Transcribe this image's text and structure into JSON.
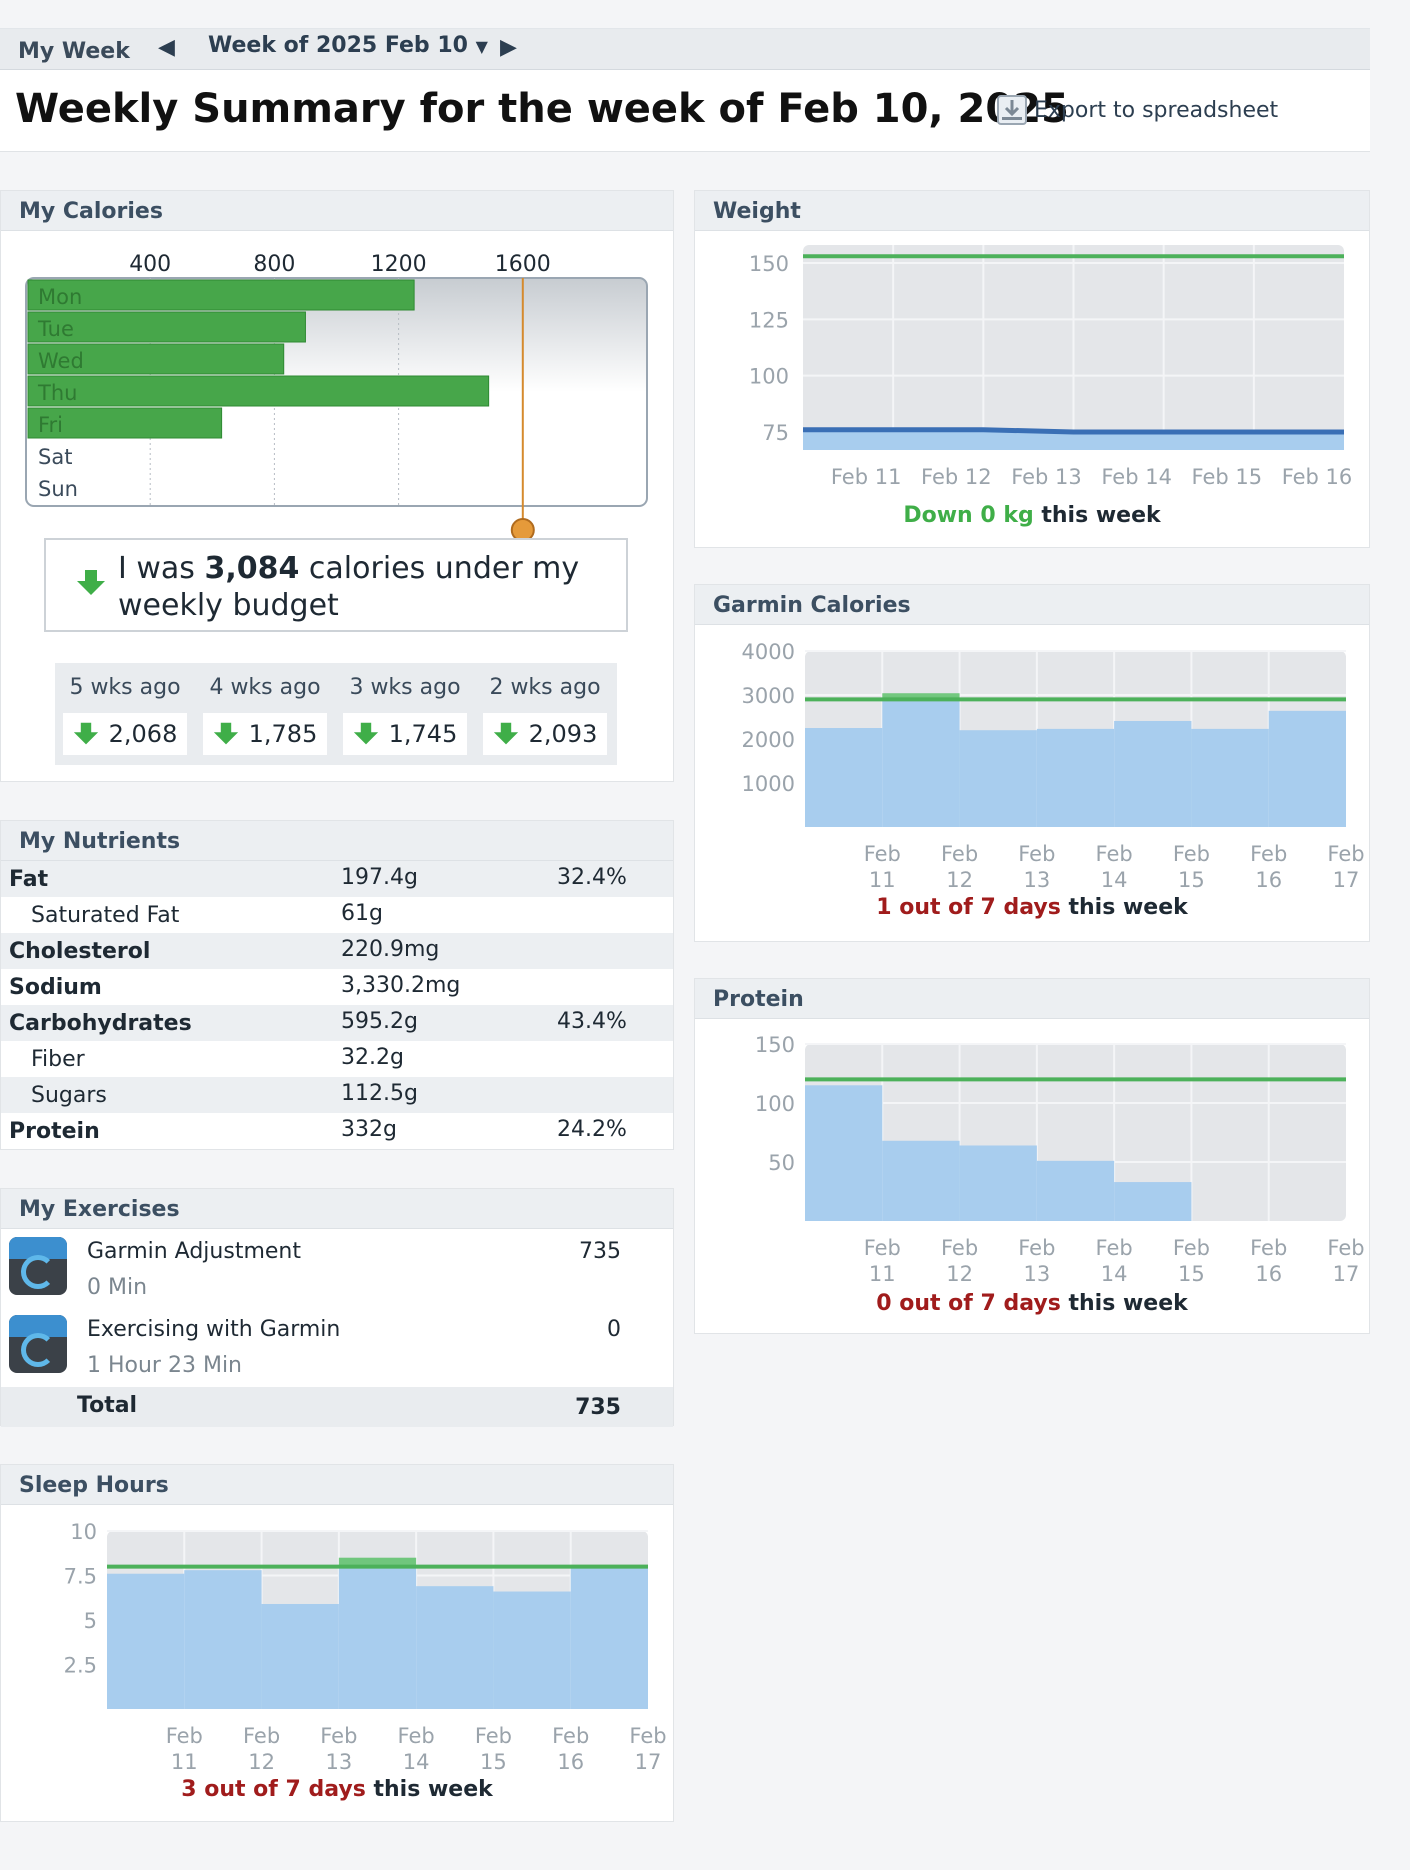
{
  "header": {
    "my_week": "My Week",
    "week_selector": "Week of 2025 Feb 10",
    "title": "Weekly Summary for the week of Feb 10, 2025",
    "export_label": "Export to spreadsheet"
  },
  "calories": {
    "title": "My Calories",
    "summary_prefix": "I was ",
    "summary_value": "3,084",
    "summary_suffix": " calories under my weekly budget",
    "previous": [
      {
        "label": "5 wks ago",
        "value": "2,068"
      },
      {
        "label": "4 wks ago",
        "value": "1,785"
      },
      {
        "label": "3 wks ago",
        "value": "1,745"
      },
      {
        "label": "2 wks ago",
        "value": "2,093"
      }
    ]
  },
  "nutrients": {
    "title": "My Nutrients",
    "rows": [
      {
        "name": "Fat",
        "value": "197.4g",
        "pct": "32.4%"
      },
      {
        "name": "Saturated Fat",
        "value": "61g",
        "pct": ""
      },
      {
        "name": "Cholesterol",
        "value": "220.9mg",
        "pct": ""
      },
      {
        "name": "Sodium",
        "value": "3,330.2mg",
        "pct": ""
      },
      {
        "name": "Carbohydrates",
        "value": "595.2g",
        "pct": "43.4%"
      },
      {
        "name": "Fiber",
        "value": "32.2g",
        "pct": ""
      },
      {
        "name": "Sugars",
        "value": "112.5g",
        "pct": ""
      },
      {
        "name": "Protein",
        "value": "332g",
        "pct": "24.2%"
      }
    ]
  },
  "exercises": {
    "title": "My Exercises",
    "items": [
      {
        "name": "Garmin Adjustment",
        "duration": "0 Min",
        "calories": "735"
      },
      {
        "name": "Exercising with Garmin",
        "duration": "1 Hour 23 Min",
        "calories": "0"
      }
    ],
    "total_label": "Total",
    "total_value": "735"
  },
  "weight": {
    "title": "Weight",
    "foot_highlight": "Down 0 kg",
    "foot_rest": " this week"
  },
  "garmin": {
    "title": "Garmin Calories",
    "foot_highlight": "1 out of 7 days",
    "foot_rest": " this week"
  },
  "protein": {
    "title": "Protein",
    "foot_highlight": "0 out of 7 days",
    "foot_rest": " this week"
  },
  "sleep": {
    "title": "Sleep Hours",
    "foot_highlight": "3 out of 7 days",
    "foot_rest": " this week"
  },
  "colors": {
    "bar_green": "#47a64a",
    "area_blue": "#a8cdee",
    "goal_green": "#4cb15a",
    "line_blue": "#3a6fb5",
    "budget_orange": "#d58a2e",
    "red_text": "#a01c1c"
  },
  "chart_data": [
    {
      "id": "calories",
      "type": "bar",
      "orientation": "horizontal",
      "categories": [
        "Mon",
        "Tue",
        "Wed",
        "Thu",
        "Fri",
        "Sat",
        "Sun"
      ],
      "values": [
        1250,
        900,
        830,
        1490,
        630,
        0,
        0
      ],
      "x_ticks": [
        400,
        800,
        1200,
        1600
      ],
      "xlim": [
        0,
        2000
      ],
      "budget_line": 1600,
      "grid": true
    },
    {
      "id": "weight",
      "type": "line",
      "x": [
        "Feb 11",
        "Feb 12",
        "Feb 13",
        "Feb 14",
        "Feb 15",
        "Feb 16"
      ],
      "values": [
        76,
        76,
        75,
        75,
        75,
        75
      ],
      "goal": 153,
      "y_ticks": [
        150,
        125,
        100,
        75
      ],
      "ylim": [
        67,
        158
      ],
      "grid": true
    },
    {
      "id": "garmin",
      "type": "area",
      "step": true,
      "x": [
        "Feb 11",
        "Feb 12",
        "Feb 13",
        "Feb 14",
        "Feb 15",
        "Feb 16",
        "Feb 17"
      ],
      "values": [
        2250,
        3040,
        2200,
        2230,
        2410,
        2230,
        2640
      ],
      "goal": 2900,
      "y_ticks": [
        4000,
        3000,
        2000,
        1000
      ],
      "ylim": [
        0,
        4000
      ],
      "grid": true
    },
    {
      "id": "protein",
      "type": "area",
      "step": true,
      "x": [
        "Feb 11",
        "Feb 12",
        "Feb 13",
        "Feb 14",
        "Feb 15",
        "Feb 16",
        "Feb 17"
      ],
      "values": [
        115,
        68,
        64,
        51,
        33,
        0,
        0
      ],
      "goal": 120,
      "y_ticks": [
        150,
        100,
        50
      ],
      "ylim": [
        0,
        150
      ],
      "grid": true
    },
    {
      "id": "sleep",
      "type": "area",
      "step": true,
      "x": [
        "Feb 11",
        "Feb 12",
        "Feb 13",
        "Feb 14",
        "Feb 15",
        "Feb 16",
        "Feb 17"
      ],
      "values": [
        7.6,
        7.8,
        5.9,
        8.5,
        6.9,
        6.6,
        8.1
      ],
      "goal": 8,
      "y_ticks": [
        10,
        7.5,
        5,
        2.5
      ],
      "ylim": [
        0,
        10
      ],
      "grid": true
    }
  ]
}
